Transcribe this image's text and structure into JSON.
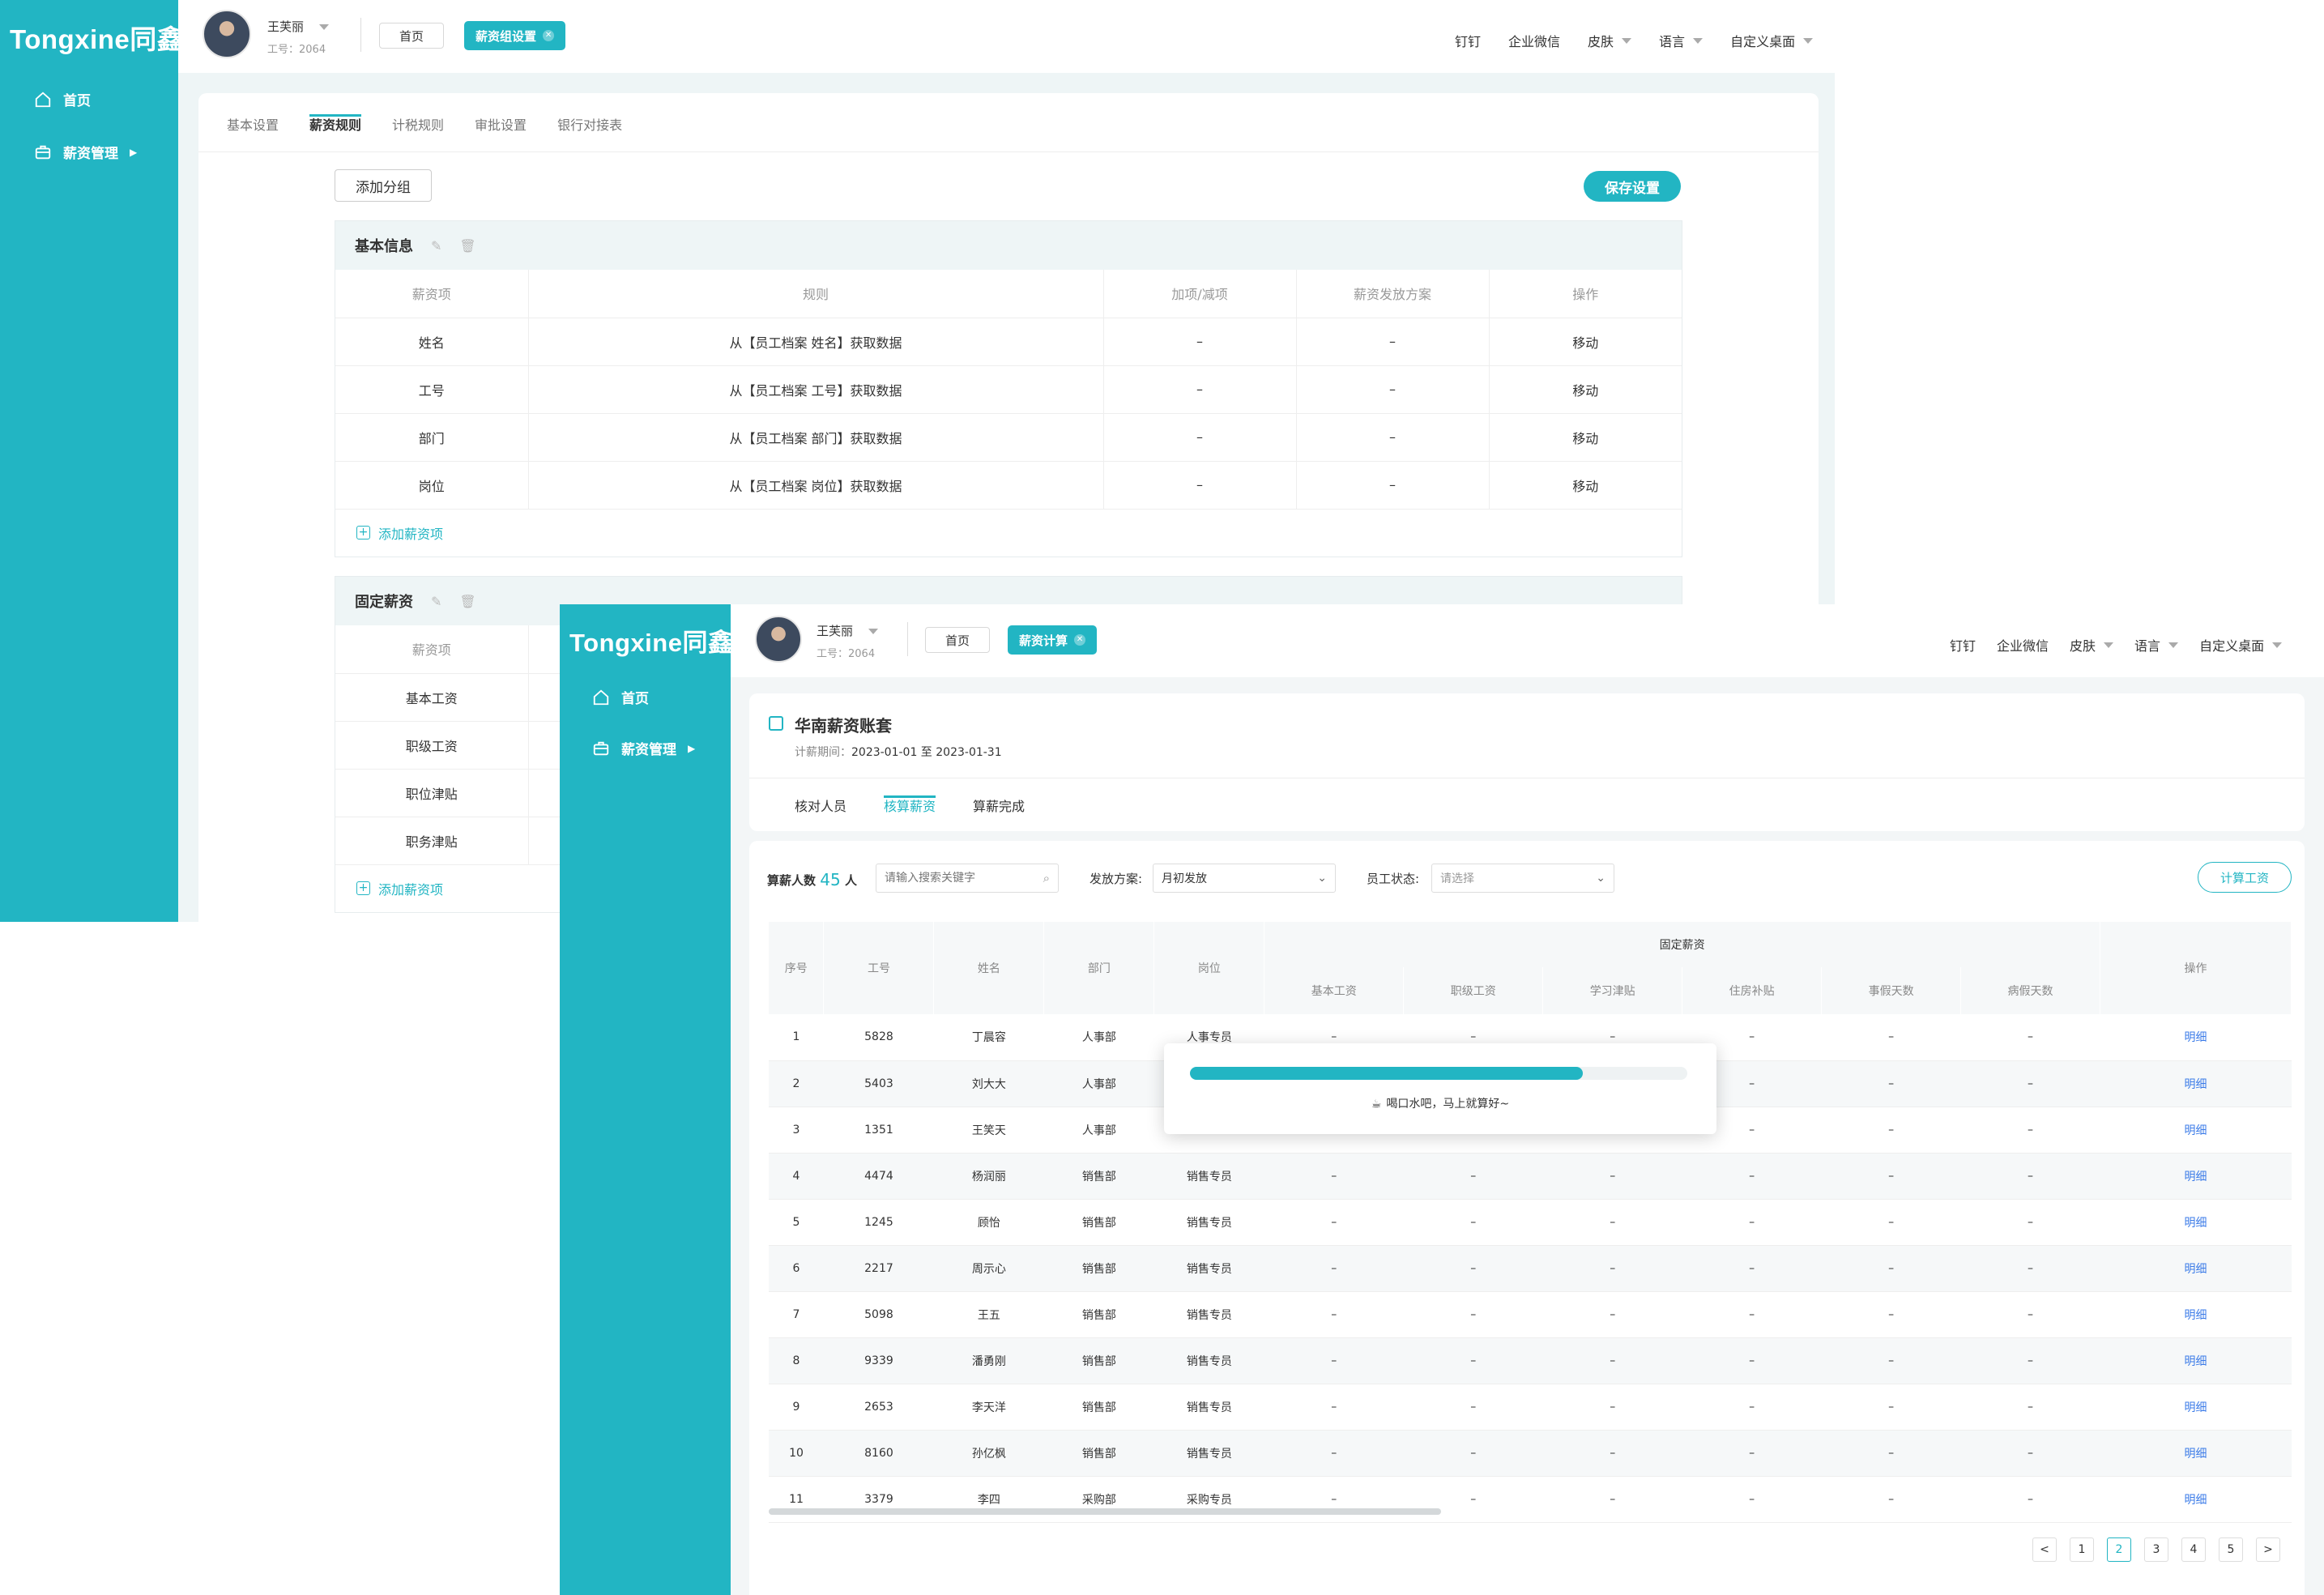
{
  "brand": {
    "logo": "Tongxine同鑫",
    "color": "#22b5c3"
  },
  "back_window": {
    "user": {
      "name": "王芙丽",
      "id": "工号：2064"
    },
    "tags": {
      "home": "首页",
      "active": "薪资组设置"
    },
    "top_menu": [
      "钉钉",
      "企业微信",
      "皮肤",
      "语言",
      "自定义桌面"
    ],
    "nav": [
      {
        "label": "首页",
        "icon": "home-icon"
      },
      {
        "label": "薪资管理",
        "icon": "briefcase-icon"
      }
    ],
    "tabs": [
      "基本设置",
      "薪资规则",
      "计税规则",
      "审批设置",
      "银行对接表"
    ],
    "active_tab": "薪资规则",
    "add_group_btn": "添加分组",
    "save_btn": "保存设置",
    "groups": [
      {
        "name": "基本信息",
        "columns": [
          "薪资项",
          "规则",
          "加项/减项",
          "薪资发放方案",
          "操作"
        ],
        "rows": [
          [
            "姓名",
            "从【员工档案 姓名】获取数据",
            "–",
            "–",
            "移动"
          ],
          [
            "工号",
            "从【员工档案 工号】获取数据",
            "–",
            "–",
            "移动"
          ],
          [
            "部门",
            "从【员工档案 部门】获取数据",
            "–",
            "–",
            "移动"
          ],
          [
            "岗位",
            "从【员工档案 岗位】获取数据",
            "–",
            "–",
            "移动"
          ]
        ],
        "add_label": "添加薪资项"
      },
      {
        "name": "固定薪资",
        "columns": [
          "薪资项"
        ],
        "rows": [
          [
            "基本工资"
          ],
          [
            "职级工资"
          ],
          [
            "职位津贴"
          ],
          [
            "职务津贴"
          ]
        ],
        "add_label": "添加薪资项"
      }
    ]
  },
  "front_window": {
    "user": {
      "name": "王芙丽",
      "id": "工号：2064"
    },
    "tags": {
      "home": "首页",
      "active": "薪资计算"
    },
    "top_menu": [
      "钉钉",
      "企业微信",
      "皮肤",
      "语言",
      "自定义桌面"
    ],
    "nav": [
      {
        "label": "首页",
        "icon": "home-icon"
      },
      {
        "label": "薪资管理",
        "icon": "briefcase-icon"
      }
    ],
    "title": "华南薪资账套",
    "period_label": "计薪期间：",
    "period_value": "2023-01-01 至 2023-01-31",
    "steps": [
      "核对人员",
      "核算薪资",
      "算薪完成"
    ],
    "active_step": "核算薪资",
    "count_label": "算薪人数",
    "count_value": "45",
    "count_unit": "人",
    "search_placeholder": "请输入搜索关键字",
    "plan_label": "发放方案:",
    "plan_value": "月初发放",
    "status_label": "员工状态:",
    "status_value": "请选择",
    "calc_btn": "计算工资",
    "table": {
      "group_header": "固定薪资",
      "columns": [
        "序号",
        "工号",
        "姓名",
        "部门",
        "岗位",
        "基本工资",
        "职级工资",
        "学习津贴",
        "住房补贴",
        "事假天数",
        "病假天数",
        "操作"
      ],
      "rows": [
        [
          "1",
          "5828",
          "丁晨容",
          "人事部",
          "人事专员"
        ],
        [
          "2",
          "5403",
          "刘大大",
          "人事部",
          ""
        ],
        [
          "3",
          "1351",
          "王笑天",
          "人事部",
          ""
        ],
        [
          "4",
          "4474",
          "杨润丽",
          "销售部",
          "销售专员"
        ],
        [
          "5",
          "1245",
          "顾怡",
          "销售部",
          "销售专员"
        ],
        [
          "6",
          "2217",
          "周示心",
          "销售部",
          "销售专员"
        ],
        [
          "7",
          "5098",
          "王五",
          "销售部",
          "销售专员"
        ],
        [
          "8",
          "9339",
          "潘勇刚",
          "销售部",
          "销售专员"
        ],
        [
          "9",
          "2653",
          "李天洋",
          "销售部",
          "销售专员"
        ],
        [
          "10",
          "8160",
          "孙亿枫",
          "销售部",
          "销售专员"
        ],
        [
          "11",
          "3379",
          "李四",
          "采购部",
          "采购专员"
        ]
      ],
      "empty_cell": "–",
      "action": "明细"
    },
    "progress": {
      "percent": 0.79,
      "message": "喝口水吧，马上就算好~"
    },
    "pagination": [
      "<",
      "1",
      "2",
      "3",
      "4",
      "5",
      ">"
    ],
    "current_page": "2"
  }
}
